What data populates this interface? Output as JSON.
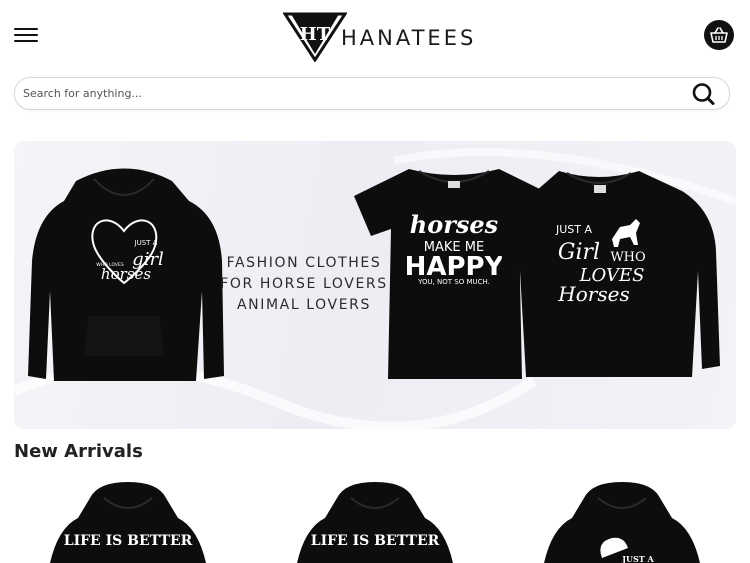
{
  "header": {
    "brand": "HANATEES",
    "logo_monogram": "HT",
    "menu_icon": "hamburger-menu-icon",
    "cart_icon": "shopping-basket-icon"
  },
  "search": {
    "placeholder": "Search for anything...",
    "value": "",
    "icon": "search-icon"
  },
  "banner": {
    "line1": "FASHION CLOTHES",
    "line2": "FOR HORSE LOVERS",
    "line3": "ANIMAL LOVERS",
    "hoodie_text": [
      "JUST A",
      "girl",
      "WHO LOVES",
      "horses"
    ],
    "tee_text": [
      "horses",
      "MAKE ME",
      "HAPPY",
      "YOU, NOT SO MUCH."
    ],
    "sweatshirt_text": [
      "JUST A",
      "Girl",
      "WHO",
      "LOVES",
      "Horses"
    ]
  },
  "new_arrivals": {
    "title": "New Arrivals",
    "items": [
      {
        "print": "LIFE IS BETTER"
      },
      {
        "print": "LIFE IS BETTER"
      },
      {
        "print": "JUST A"
      }
    ]
  },
  "colors": {
    "garment": "#0d0d0d",
    "accent": "#111111"
  }
}
